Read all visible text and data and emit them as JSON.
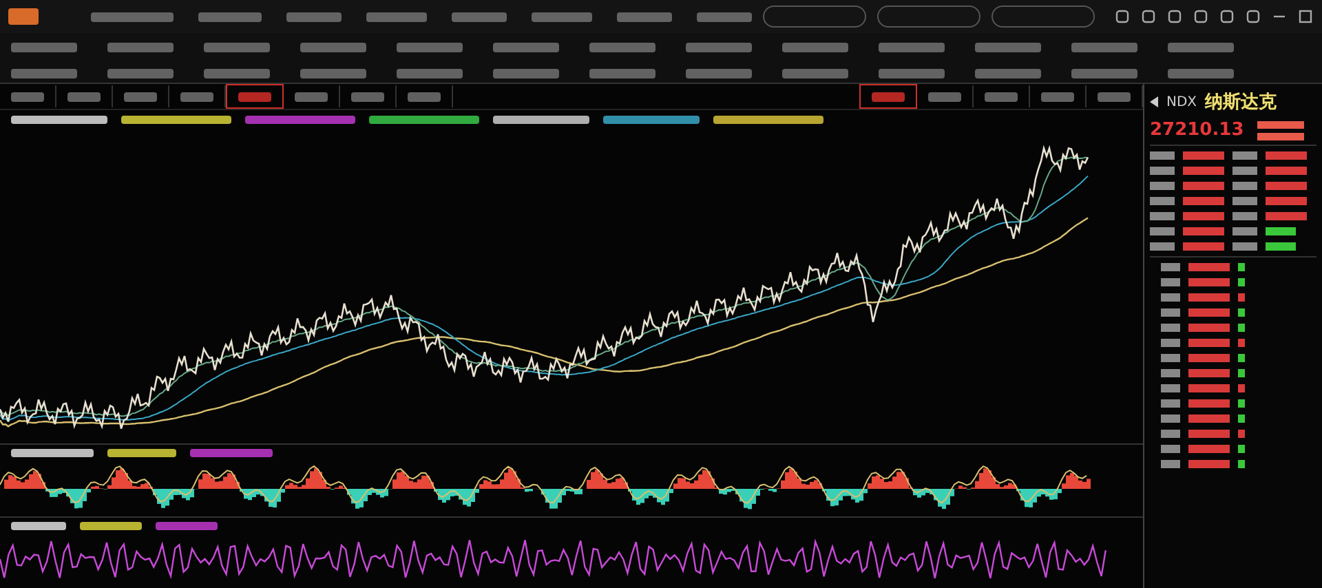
{
  "period_tabs": [
    {
      "selected": false
    },
    {
      "selected": false
    },
    {
      "selected": false
    },
    {
      "selected": false
    },
    {
      "selected": true
    },
    {
      "selected": false
    },
    {
      "selected": false
    },
    {
      "selected": false
    }
  ],
  "chart_tabs": [
    {
      "selected": true
    },
    {
      "selected": false
    },
    {
      "selected": false
    },
    {
      "selected": false
    },
    {
      "selected": false
    }
  ],
  "quote": {
    "code": "NDX",
    "name": "纳斯达克",
    "price": "27210.13"
  }
}
